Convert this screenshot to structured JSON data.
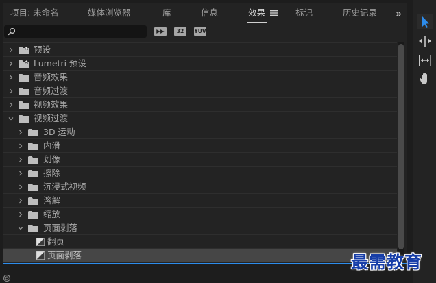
{
  "tabs": [
    {
      "label": "项目: 未命名",
      "active": false
    },
    {
      "label": "媒体浏览器",
      "active": false
    },
    {
      "label": "库",
      "active": false
    },
    {
      "label": "信息",
      "active": false
    },
    {
      "label": "效果",
      "active": true
    },
    {
      "label": "标记",
      "active": false
    },
    {
      "label": "历史记录",
      "active": false
    }
  ],
  "search": {
    "value": "",
    "placeholder": ""
  },
  "filter_buttons": [
    {
      "label": "▶▶",
      "icon": "accelerated-effects-icon"
    },
    {
      "label": "32",
      "icon": "32-bit-color-icon"
    },
    {
      "label": "YUV",
      "icon": "yuv-effects-icon"
    }
  ],
  "tree": [
    {
      "label": "预设",
      "level": 0,
      "expanded": false,
      "type": "folder-star"
    },
    {
      "label": "Lumetri 预设",
      "level": 0,
      "expanded": false,
      "type": "folder-star"
    },
    {
      "label": "音频效果",
      "level": 0,
      "expanded": false,
      "type": "folder"
    },
    {
      "label": "音频过渡",
      "level": 0,
      "expanded": false,
      "type": "folder"
    },
    {
      "label": "视频效果",
      "level": 0,
      "expanded": false,
      "type": "folder"
    },
    {
      "label": "视频过渡",
      "level": 0,
      "expanded": true,
      "type": "folder"
    },
    {
      "label": "3D 运动",
      "level": 1,
      "expanded": false,
      "type": "folder"
    },
    {
      "label": "内滑",
      "level": 1,
      "expanded": false,
      "type": "folder"
    },
    {
      "label": "划像",
      "level": 1,
      "expanded": false,
      "type": "folder"
    },
    {
      "label": "擦除",
      "level": 1,
      "expanded": false,
      "type": "folder"
    },
    {
      "label": "沉浸式视频",
      "level": 1,
      "expanded": false,
      "type": "folder"
    },
    {
      "label": "溶解",
      "level": 1,
      "expanded": false,
      "type": "folder"
    },
    {
      "label": "缩放",
      "level": 1,
      "expanded": false,
      "type": "folder"
    },
    {
      "label": "页面剥落",
      "level": 1,
      "expanded": true,
      "type": "folder"
    },
    {
      "label": "翻页",
      "level": 2,
      "type": "effect",
      "selected": false
    },
    {
      "label": "页面剥落",
      "level": 2,
      "type": "effect",
      "selected": true
    }
  ],
  "tools": [
    "selection-tool-icon",
    "track-select-tool-icon",
    "ripple-edit-tool-icon",
    "hand-tool-icon"
  ],
  "watermark": "最需教育",
  "colors": {
    "accent": "#2d8ceb",
    "panel": "#232323",
    "selected_row": "#464646",
    "watermark": "#173ea8"
  }
}
